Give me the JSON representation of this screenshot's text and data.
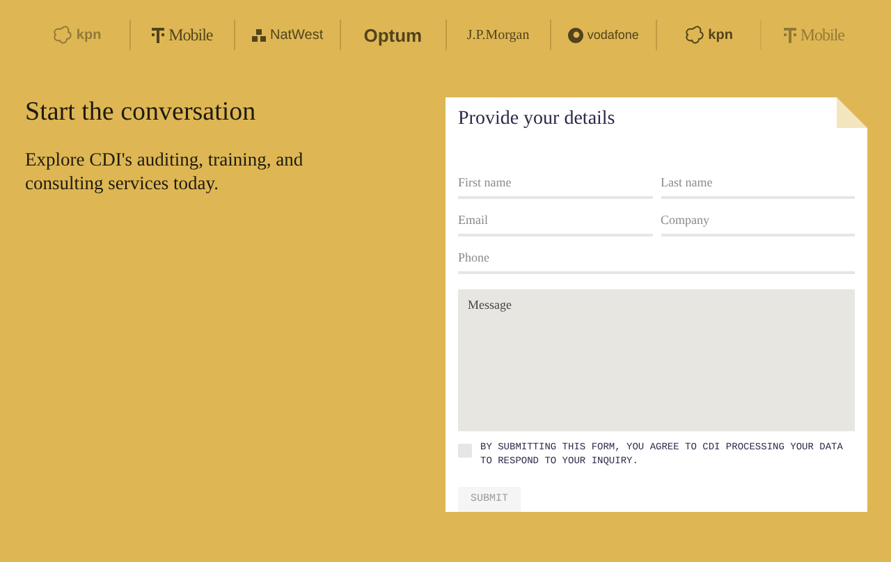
{
  "logos": [
    {
      "kind": "kpn",
      "name": "kpn",
      "faded": true
    },
    {
      "kind": "tmobile",
      "name": "Mobile",
      "faded": false
    },
    {
      "kind": "natwest",
      "name": "NatWest",
      "faded": false
    },
    {
      "kind": "optum",
      "name": "Optum",
      "faded": false
    },
    {
      "kind": "jpmorgan",
      "name": "J.P.Morgan",
      "faded": false
    },
    {
      "kind": "vodafone",
      "name": "vodafone",
      "faded": false
    },
    {
      "kind": "kpn",
      "name": "kpn",
      "faded": false
    },
    {
      "kind": "tmobile",
      "name": "Mobile",
      "faded": true
    }
  ],
  "intro": {
    "heading": "Start the conversation",
    "text": "Explore CDI's auditing, training, and consulting services today."
  },
  "form": {
    "title": "Provide your details",
    "fields": [
      {
        "placeholder": "First name",
        "kind": "half"
      },
      {
        "placeholder": "Last name",
        "kind": "half"
      },
      {
        "placeholder": "Email",
        "kind": "half"
      },
      {
        "placeholder": "Company",
        "kind": "half"
      },
      {
        "placeholder": "Phone",
        "kind": "full"
      }
    ],
    "message": {
      "placeholder": "Message"
    },
    "consent": {
      "checked": false,
      "text": "BY SUBMITTING THIS FORM, YOU AGREE TO CDI PROCESSING YOUR DATA TO RESPOND TO YOUR INQUIRY."
    },
    "submit": {
      "label": "SUBMIT",
      "disabled": true
    }
  }
}
